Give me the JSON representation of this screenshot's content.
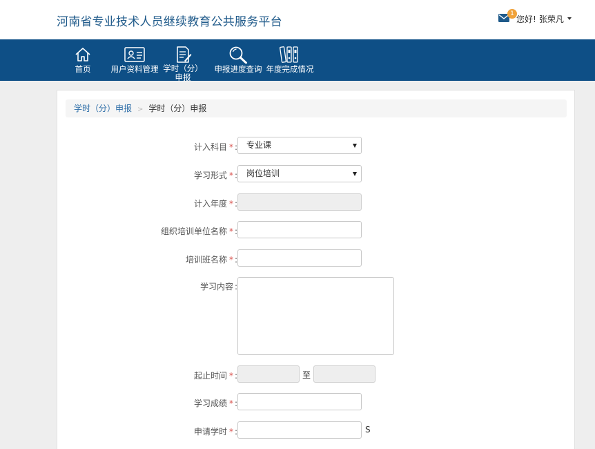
{
  "header": {
    "site_title": "河南省专业技术人员继续教育公共服务平台",
    "notification_count": "1",
    "greeting": "您好!",
    "username": "张荣凡"
  },
  "nav": [
    {
      "label": "首页",
      "icon": "home-icon"
    },
    {
      "label": "用户资料管理",
      "icon": "id-card-icon"
    },
    {
      "label": "学时（分）申报",
      "icon": "document-edit-icon"
    },
    {
      "label": "申报进度查询",
      "icon": "search-icon"
    },
    {
      "label": "年度完成情况",
      "icon": "binders-icon"
    }
  ],
  "breadcrumb": {
    "link": "学时（分）申报",
    "separator": ">",
    "current": "学时（分）申报"
  },
  "form": {
    "subject": {
      "label": "计入科目",
      "value": "专业课"
    },
    "study_form": {
      "label": "学习形式",
      "value": "岗位培训"
    },
    "year": {
      "label": "计入年度",
      "value": ""
    },
    "org_name": {
      "label": "组织培训单位名称",
      "value": ""
    },
    "class_name": {
      "label": "培训班名称",
      "value": ""
    },
    "content": {
      "label": "学习内容",
      "value": ""
    },
    "period": {
      "label": "起止时间",
      "to": "至",
      "start": "",
      "end": ""
    },
    "score": {
      "label": "学习成绩",
      "value": ""
    },
    "hours": {
      "label": "申请学时",
      "value": "",
      "unit": "S"
    }
  },
  "colors": {
    "nav_bg": "#0e4f86",
    "title": "#1f5a8a",
    "required": "#d9534f",
    "badge": "#f0a23a"
  }
}
